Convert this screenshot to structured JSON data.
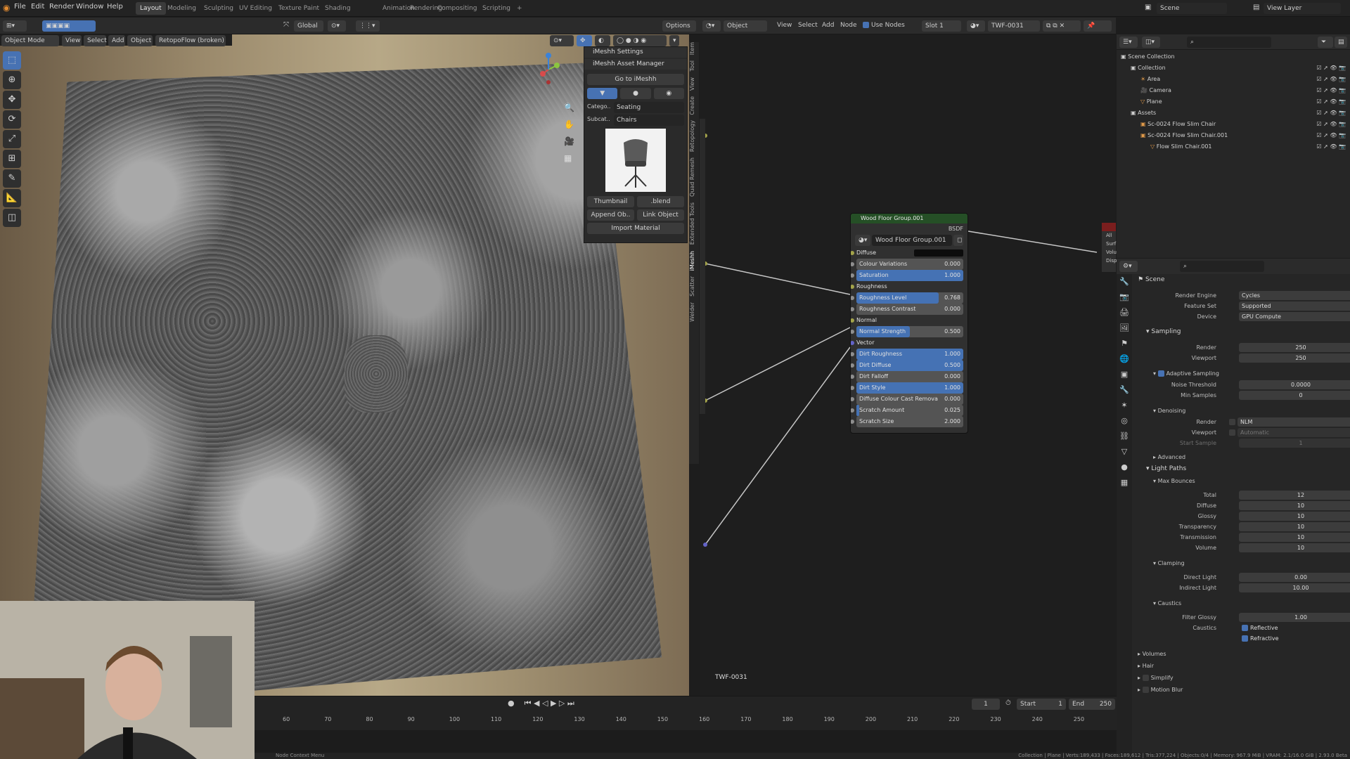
{
  "topbar": {
    "menus": [
      "File",
      "Edit",
      "Render",
      "Window",
      "Help"
    ],
    "workspaces": [
      "Layout",
      "Modeling",
      "Sculpting",
      "UV Editing",
      "Texture Paint",
      "Shading",
      "Animation",
      "Rendering",
      "Compositing",
      "Scripting"
    ],
    "add_tab": "+",
    "scene": "Scene",
    "view_layer": "View Layer"
  },
  "viewport_header": {
    "transform": "Global",
    "options": "Options",
    "mode": "Object Mode",
    "menus": [
      "View",
      "Select",
      "Add",
      "Object"
    ],
    "retopo": "RetopoFlow (broken)"
  },
  "asset_panel": {
    "settings_title": "iMeshh Settings",
    "manager_title": "iMeshh Asset Manager",
    "goto": "Go to iMeshh",
    "category_label": "Catego..",
    "category_value": "Seating",
    "subcat_label": "Subcat..",
    "subcat_value": "Chairs",
    "thumbnail": "Thumbnail",
    "blend": ".blend",
    "append": "Append Ob..",
    "link": "Link Object",
    "import_material": "Import Material"
  },
  "vertical_tabs": [
    "Item",
    "Tool",
    "View",
    "Create",
    "Retopology",
    "Quad Remesh",
    "Extended Tools",
    "iMeshh",
    "Scatter",
    "Welder"
  ],
  "node_header": {
    "editor": "Object",
    "menus": [
      "View",
      "Select",
      "Add",
      "Node"
    ],
    "use_nodes": "Use Nodes",
    "slot": "Slot 1",
    "material": "TWF-0031"
  },
  "node": {
    "title": "Wood Floor Group.001",
    "output": "BSDF",
    "group_name": "Wood Floor Group.001",
    "rows": [
      {
        "label": "Diffuse",
        "type": "color",
        "socket": "yellow"
      },
      {
        "label": "Colour Variations",
        "value": "0.000",
        "fill": 0.0,
        "socket": "gray"
      },
      {
        "label": "Saturation",
        "value": "1.000",
        "fill": 1.0,
        "socket": "gray"
      },
      {
        "label": "Roughness",
        "type": "header",
        "socket": "yellow"
      },
      {
        "label": "Roughness Level",
        "value": "0.768",
        "fill": 0.768,
        "socket": "gray"
      },
      {
        "label": "Roughness Contrast",
        "value": "0.000",
        "fill": 0.0,
        "socket": "gray"
      },
      {
        "label": "Normal",
        "type": "header",
        "socket": "yellow"
      },
      {
        "label": "Normal Strength",
        "value": "0.500",
        "fill": 0.5,
        "socket": "gray"
      },
      {
        "label": "Vector",
        "type": "header",
        "socket": "blue"
      },
      {
        "label": "Dirt Roughness",
        "value": "1.000",
        "fill": 1.0,
        "socket": "gray"
      },
      {
        "label": "Dirt Diffuse",
        "value": "0.500",
        "fill": 1.0,
        "socket": "gray"
      },
      {
        "label": "Dirt Falloff",
        "value": "0.000",
        "fill": 0.0,
        "socket": "gray"
      },
      {
        "label": "Dirt Style",
        "value": "1.000",
        "fill": 1.0,
        "socket": "gray"
      },
      {
        "label": "Diffuse Colour Cast Remova",
        "value": "0.000",
        "fill": 0.0,
        "socket": "gray"
      },
      {
        "label": "Scratch Amount",
        "value": "0.025",
        "fill": 0.025,
        "socket": "gray"
      },
      {
        "label": "Scratch Size",
        "value": "2.000",
        "fill": 0.0,
        "socket": "gray"
      }
    ],
    "material_label": "TWF-0031",
    "output_node_sockets": [
      "All",
      "Surf",
      "Volu",
      "Disp"
    ]
  },
  "outliner": {
    "rows": [
      {
        "label": "Scene Collection",
        "indent": 0
      },
      {
        "label": "Collection",
        "indent": 1
      },
      {
        "label": "Area",
        "indent": 2
      },
      {
        "label": "Camera",
        "indent": 2
      },
      {
        "label": "Plane",
        "indent": 2
      },
      {
        "label": "Assets",
        "indent": 1
      },
      {
        "label": "Sc-0024 Flow Slim Chair",
        "indent": 2
      },
      {
        "label": "Sc-0024 Flow Slim Chair.001",
        "indent": 2
      },
      {
        "label": "Flow Slim Chair.001",
        "indent": 3
      }
    ]
  },
  "properties": {
    "context": "Scene",
    "render_engine_label": "Render Engine",
    "render_engine": "Cycles",
    "feature_set_label": "Feature Set",
    "feature_set": "Supported",
    "device_label": "Device",
    "device": "GPU Compute",
    "sampling": "Sampling",
    "render_label": "Render",
    "render_samples": "250",
    "viewport_label": "Viewport",
    "viewport_samples": "250",
    "adaptive": "Adaptive Sampling",
    "noise_threshold_label": "Noise Threshold",
    "noise_threshold": "0.0000",
    "min_samples_label": "Min Samples",
    "min_samples": "0",
    "denoising": "Denoising",
    "denoise_render": "NLM",
    "denoise_viewport": "Automatic",
    "start_sample_label": "Start Sample",
    "start_sample": "1",
    "advanced": "Advanced",
    "light_paths": "Light Paths",
    "max_bounces": "Max Bounces",
    "bounces": [
      {
        "label": "Total",
        "value": "12"
      },
      {
        "label": "Diffuse",
        "value": "10"
      },
      {
        "label": "Glossy",
        "value": "10"
      },
      {
        "label": "Transparency",
        "value": "10"
      },
      {
        "label": "Transmission",
        "value": "10"
      },
      {
        "label": "Volume",
        "value": "10"
      }
    ],
    "clamping": "Clamping",
    "direct_light_label": "Direct Light",
    "direct_light": "0.00",
    "indirect_light_label": "Indirect Light",
    "indirect_light": "10.00",
    "caustics": "Caustics",
    "filter_glossy_label": "Filter Glossy",
    "filter_glossy": "1.00",
    "caustics_label": "Caustics",
    "reflective": "Reflective",
    "refractive": "Refractive",
    "volumes": "Volumes",
    "hair": "Hair",
    "simplify": "Simplify",
    "motion_blur": "Motion Blur"
  },
  "timeline": {
    "current_frame": "1",
    "start_label": "Start",
    "start": "1",
    "end_label": "End",
    "end": "250",
    "ticks": [
      "60",
      "70",
      "80",
      "90",
      "100",
      "110",
      "120",
      "130",
      "140",
      "150",
      "160",
      "170",
      "180",
      "190",
      "200",
      "210",
      "220",
      "230",
      "240",
      "250"
    ]
  },
  "statusbar": {
    "left": "Node Context Menu",
    "right": "Collection | Plane | Verts:189,433 | Faces:189,612 | Tris:377,224 | Objects:0/4 | Memory: 967.9 MiB | VRAM: 2.1/16.0 GiB | 2.93.0 Beta"
  }
}
